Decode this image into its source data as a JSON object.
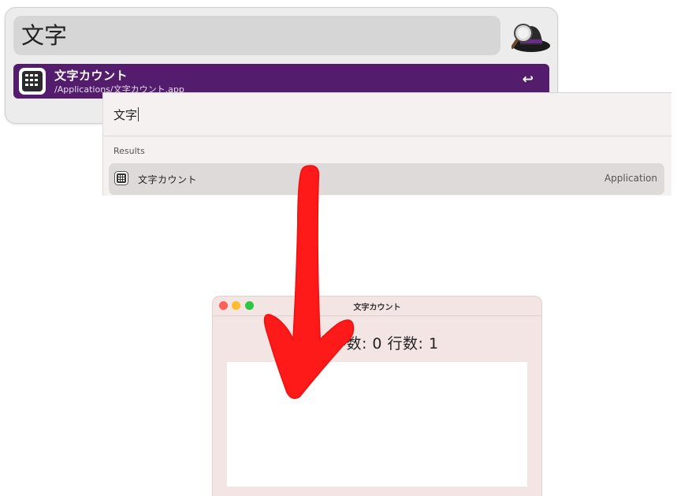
{
  "alfred": {
    "query": "文字",
    "result": {
      "title": "文字カウント",
      "subtitle": "/Applications/文字カウント.app",
      "action_glyph": "↩"
    },
    "icons": {
      "logo": "alfred-hat-icon",
      "app": "calculator-keypad-icon"
    },
    "colors": {
      "selection": "#541c6c"
    }
  },
  "spotlight": {
    "query": "文字",
    "section_label": "Results",
    "result": {
      "title": "文字カウント",
      "kind": "Application"
    }
  },
  "app_window": {
    "title": "文字カウント",
    "counts_text": "文字数: 0 行数: 1",
    "colors": {
      "background": "#f3e5e3",
      "textarea": "#ffffff"
    }
  },
  "annotation": {
    "arrow_color": "#ff1a1a"
  }
}
